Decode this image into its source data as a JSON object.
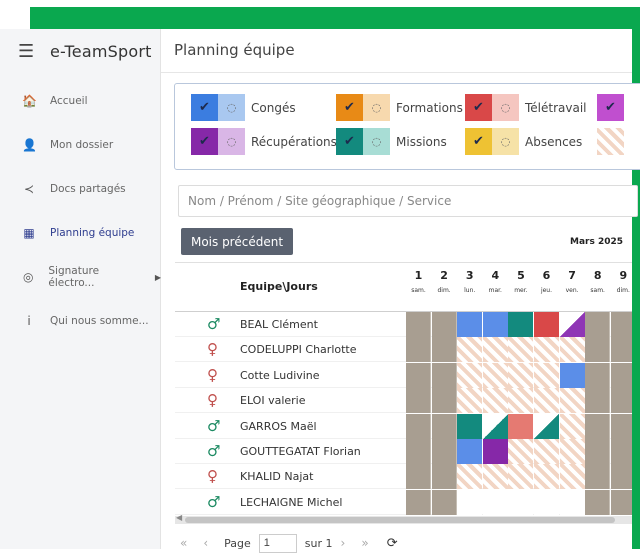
{
  "app": {
    "brand": "e-TeamSport",
    "page_title": "Planning équipe"
  },
  "sidebar": {
    "items": [
      {
        "label": "Accueil",
        "icon": "home-icon",
        "glyph": "🏠"
      },
      {
        "label": "Mon dossier",
        "icon": "user-icon",
        "glyph": "👤"
      },
      {
        "label": "Docs partagés",
        "icon": "share-icon",
        "glyph": "≺"
      },
      {
        "label": "Planning équipe",
        "icon": "calendar-icon",
        "glyph": "▦"
      },
      {
        "label": "Signature électro...",
        "icon": "signature-icon",
        "glyph": "◎",
        "arrow": "▶"
      },
      {
        "label": "Qui nous somme...",
        "icon": "info-icon",
        "glyph": "i"
      }
    ]
  },
  "legend": [
    {
      "label": "Congés",
      "color": "#3b7de0",
      "light": "#a9c8f0"
    },
    {
      "label": "Formations",
      "color": "#e88a16",
      "light": "#f7d9ae"
    },
    {
      "label": "Télétravail",
      "color": "#d94848",
      "light": "#f5c6c0"
    },
    {
      "label": "Récupérations",
      "color": "#8628a8",
      "light": "#d9b6e6"
    },
    {
      "label": "Missions",
      "color": "#138a7e",
      "light": "#a8ddd5"
    },
    {
      "label": "Absences",
      "color": "#eec233",
      "light": "#f6e2a7"
    }
  ],
  "legend_extra": {
    "color": "#c04fcf"
  },
  "search": {
    "placeholder": "Nom / Prénom / Site géographique / Service"
  },
  "toolbar": {
    "prev_label": "Mois précédent",
    "month": "Mars 2025"
  },
  "grid": {
    "team_header": "Equipe\\Jours",
    "days": [
      {
        "num": "1",
        "name": "sam."
      },
      {
        "num": "2",
        "name": "dim."
      },
      {
        "num": "3",
        "name": "lun."
      },
      {
        "num": "4",
        "name": "mar."
      },
      {
        "num": "5",
        "name": "mer."
      },
      {
        "num": "6",
        "name": "jeu."
      },
      {
        "num": "7",
        "name": "ven."
      },
      {
        "num": "8",
        "name": "sam."
      },
      {
        "num": "9",
        "name": "dim."
      }
    ],
    "employees": [
      {
        "name": "BEAL Clément",
        "gender": "male",
        "cells": [
          "weekend",
          "weekend",
          "conges",
          "conges",
          "missions",
          "teletravail",
          "tri-recup",
          "weekend",
          "weekend"
        ]
      },
      {
        "name": "CODELUPPI Charlotte",
        "gender": "female",
        "cells": [
          "weekend",
          "weekend",
          "absence",
          "absence",
          "absence",
          "absence",
          "absence",
          "weekend",
          "weekend"
        ]
      },
      {
        "name": "Cotte Ludivine",
        "gender": "female",
        "cells": [
          "weekend",
          "weekend",
          "absence",
          "absence",
          "absence",
          "absence",
          "conges",
          "weekend",
          "weekend"
        ]
      },
      {
        "name": "ELOI valerie",
        "gender": "female",
        "cells": [
          "weekend",
          "weekend",
          "absence",
          "absence",
          "absence",
          "absence",
          "absence",
          "weekend",
          "weekend"
        ]
      },
      {
        "name": "GARROS Maël",
        "gender": "male",
        "cells": [
          "weekend",
          "weekend",
          "missions",
          "tri-mission",
          "teletravail-light",
          "tri-mission",
          "absence",
          "weekend",
          "weekend"
        ]
      },
      {
        "name": "GOUTTEGATAT Florian",
        "gender": "male",
        "cells": [
          "weekend",
          "weekend",
          "conges",
          "recup",
          "absence",
          "absence",
          "absence",
          "weekend",
          "weekend"
        ]
      },
      {
        "name": "KHALID Najat",
        "gender": "female",
        "cells": [
          "weekend",
          "weekend",
          "absence",
          "absence",
          "absence",
          "absence",
          "absence",
          "weekend",
          "weekend"
        ]
      },
      {
        "name": "LECHAIGNE Michel",
        "gender": "male",
        "cells": [
          "weekend",
          "weekend",
          "empty",
          "empty",
          "empty",
          "empty",
          "empty",
          "weekend",
          "weekend"
        ]
      }
    ]
  },
  "pager": {
    "page_label": "Page",
    "page_value": "1",
    "of_label": "sur 1",
    "first": "«",
    "prev": "‹",
    "next": "›",
    "last": "»",
    "refresh": "⟳"
  }
}
